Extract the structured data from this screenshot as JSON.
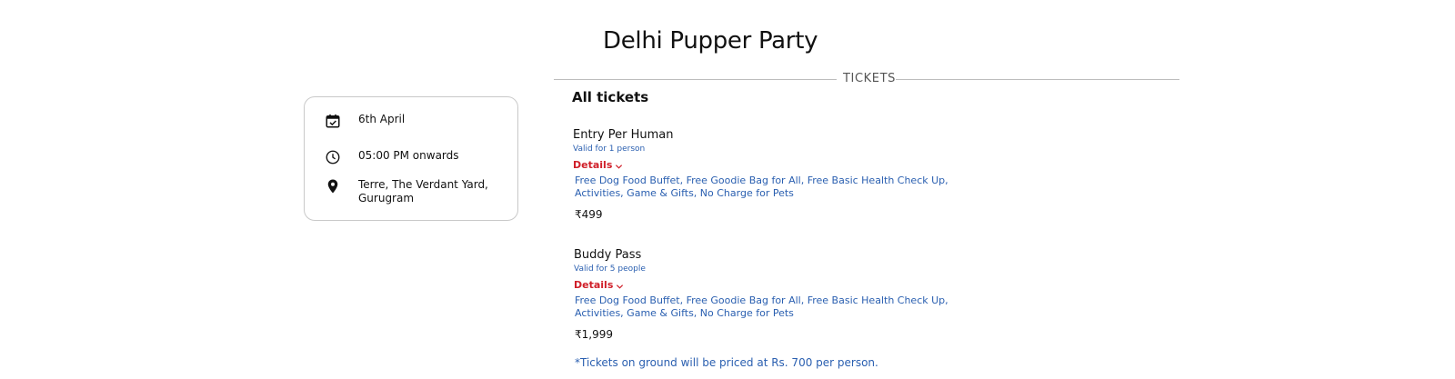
{
  "event": {
    "title": "Delhi Pupper Party"
  },
  "info": {
    "date": "6th April",
    "time": "05:00 PM onwards",
    "venue": "Terre, The Verdant Yard, Gurugram",
    "icons": [
      "calendar-check-icon",
      "clock-icon",
      "location-pin-icon"
    ]
  },
  "tickets_section": {
    "divider_label": "TICKETS",
    "heading": "All tickets",
    "items": [
      {
        "name": "Entry Per Human",
        "validity": "Valid for 1 person",
        "details_label": "Details",
        "benefits": "Free Dog Food Buffet, Free Goodie Bag for All, Free Basic Health Check Up, Activities, Game & Gifts, No Charge for Pets",
        "price": "₹499"
      },
      {
        "name": "Buddy Pass",
        "validity": "Valid for 5 people",
        "details_label": "Details",
        "benefits": "Free Dog Food Buffet, Free Goodie Bag for All, Free Basic Health Check Up, Activities, Game & Gifts, No Charge for Pets",
        "price": "₹1,999"
      }
    ],
    "footnote": "*Tickets on ground will be priced at Rs. 700 per person."
  },
  "colors": {
    "link_blue": "#2a5fb0",
    "details_red": "#d0202a",
    "text": "#111111",
    "border": "#c9c9c9"
  }
}
